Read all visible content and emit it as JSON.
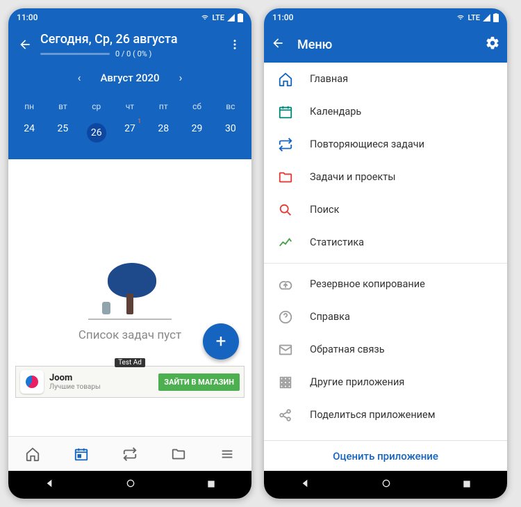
{
  "status": {
    "time": "11:00",
    "net": "LTE"
  },
  "left": {
    "title": "Сегодня, Ср, 26 августа",
    "progress": "0 / 0  ( 0% )",
    "month": "Август 2020",
    "weekdays": [
      "пн",
      "вт",
      "ср",
      "чт",
      "пт",
      "сб",
      "вс"
    ],
    "dates": [
      "24",
      "25",
      "26",
      "27",
      "28",
      "29",
      "30"
    ],
    "today_index": 2,
    "badge_index": 3,
    "badge_value": "1",
    "empty": "Список задач пуст",
    "ad": {
      "badge": "Test Ad",
      "title": "Joom",
      "subtitle": "Лучшие товары",
      "cta": "ЗАЙТИ В МАГАЗИН"
    }
  },
  "right": {
    "title": "Меню",
    "items1": [
      {
        "label": "Главная",
        "icon": "home",
        "color": "#1565c0"
      },
      {
        "label": "Календарь",
        "icon": "calendar",
        "color": "#00897b"
      },
      {
        "label": "Повторяющиеся задачи",
        "icon": "repeat",
        "color": "#1565c0"
      },
      {
        "label": "Задачи и проекты",
        "icon": "folder",
        "color": "#e53935"
      },
      {
        "label": "Поиск",
        "icon": "search",
        "color": "#e53935"
      },
      {
        "label": "Статистика",
        "icon": "stats",
        "color": "#43a047"
      }
    ],
    "items2": [
      {
        "label": "Резервное копирование",
        "icon": "backup",
        "color": "#9e9e9e"
      },
      {
        "label": "Справка",
        "icon": "help",
        "color": "#9e9e9e"
      },
      {
        "label": "Обратная связь",
        "icon": "mail",
        "color": "#9e9e9e"
      },
      {
        "label": "Другие приложения",
        "icon": "apps",
        "color": "#9e9e9e"
      },
      {
        "label": "Поделиться приложением",
        "icon": "share",
        "color": "#9e9e9e"
      }
    ],
    "rate": "Оценить приложение"
  }
}
